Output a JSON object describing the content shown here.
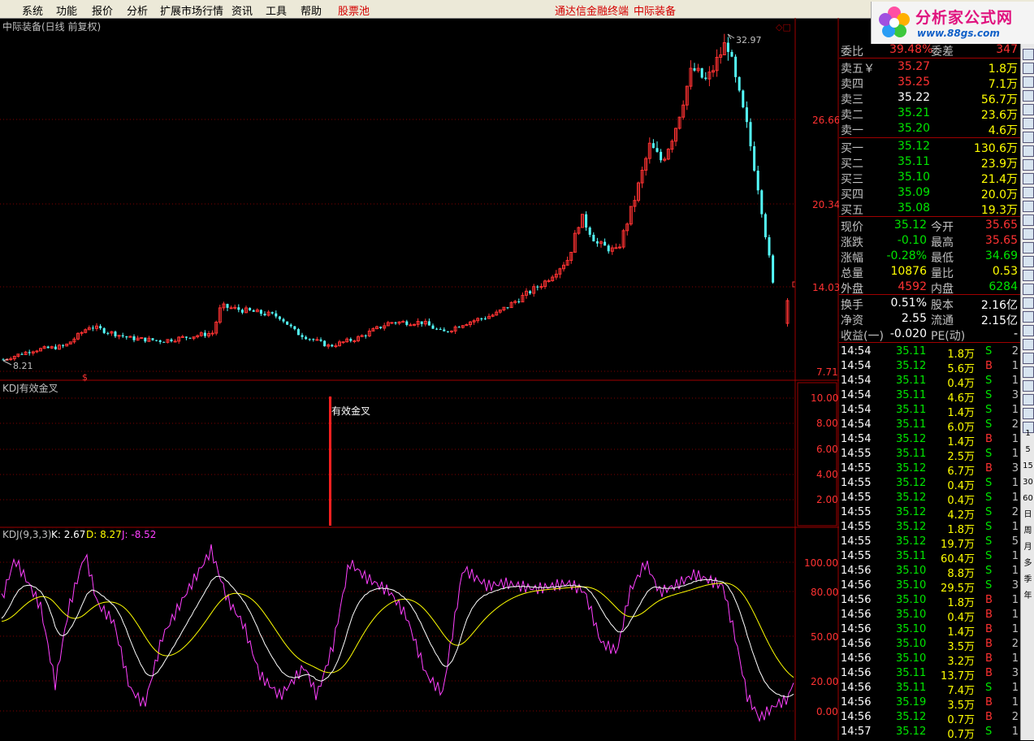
{
  "menu": {
    "items": [
      "系统",
      "功能",
      "报价",
      "分析",
      "扩展市场行情",
      "资讯",
      "工具",
      "帮助"
    ],
    "stock_pool": "股票池",
    "terminal": "通达信金融终端",
    "stock": "中际装备"
  },
  "logo": {
    "brand": "分析家公式网",
    "url": "www.88gs.com"
  },
  "panels": {
    "main_title": "中际装备(日线 前复权)",
    "signal_title": "KDJ有效金叉",
    "signal_text": "有效金叉",
    "kdj_title": "KDJ(9,3,3)",
    "kdj_k": "K: 2.67",
    "kdj_d": "D: 8.27",
    "kdj_j": "J: -8.52",
    "buy_marker": "$"
  },
  "chart_data": {
    "type": "candlestick",
    "price_axis_ticks": [
      "26.66",
      "20.34",
      "14.03",
      "7.71"
    ],
    "price_axis_values": [
      26.66,
      20.34,
      14.03,
      7.71
    ],
    "high_annotation": "32.97",
    "low_annotation": "8.21",
    "signal_axis_ticks": [
      "10.00",
      "8.00",
      "6.00",
      "4.00",
      "2.00"
    ],
    "kdj_axis_ticks": [
      "100.00",
      "80.00",
      "50.00",
      "20.00",
      "0.00"
    ],
    "colors": {
      "up": "#ff3232",
      "down": "#54fcfc",
      "grid": "#800000",
      "k": "#ffffff",
      "d": "#ffff00",
      "j": "#ff40ff"
    }
  },
  "quote": {
    "weibi_label": "委比",
    "weibi_value": "39.48%",
    "weicha_label": "委差",
    "weicha_value": "347",
    "asks": [
      {
        "label": "卖五￥",
        "price": "35.27",
        "vol": "1.8万",
        "pc": "r"
      },
      {
        "label": "卖四",
        "price": "35.25",
        "vol": "7.1万",
        "pc": "r"
      },
      {
        "label": "卖三",
        "price": "35.22",
        "vol": "56.7万",
        "pc": "w"
      },
      {
        "label": "卖二",
        "price": "35.21",
        "vol": "23.6万",
        "pc": "g"
      },
      {
        "label": "卖一",
        "price": "35.20",
        "vol": "4.6万",
        "pc": "g"
      }
    ],
    "bids": [
      {
        "label": "买一",
        "price": "35.12",
        "vol": "130.6万",
        "pc": "g"
      },
      {
        "label": "买二",
        "price": "35.11",
        "vol": "23.9万",
        "pc": "g"
      },
      {
        "label": "买三",
        "price": "35.10",
        "vol": "21.4万",
        "pc": "g"
      },
      {
        "label": "买四",
        "price": "35.09",
        "vol": "20.0万",
        "pc": "g"
      },
      {
        "label": "买五",
        "price": "35.08",
        "vol": "19.3万",
        "pc": "g"
      }
    ],
    "stats": [
      {
        "l1": "现价",
        "v1": "35.12",
        "c1": "g",
        "l2": "今开",
        "v2": "35.65",
        "c2": "r"
      },
      {
        "l1": "涨跌",
        "v1": "-0.10",
        "c1": "g",
        "l2": "最高",
        "v2": "35.65",
        "c2": "r"
      },
      {
        "l1": "涨幅",
        "v1": "-0.28%",
        "c1": "g",
        "l2": "最低",
        "v2": "34.69",
        "c2": "g"
      },
      {
        "l1": "总量",
        "v1": "10876",
        "c1": "y",
        "l2": "量比",
        "v2": "0.53",
        "c2": "y"
      },
      {
        "l1": "外盘",
        "v1": "4592",
        "c1": "r",
        "l2": "内盘",
        "v2": "6284",
        "c2": "g"
      }
    ],
    "stats2": [
      {
        "l1": "换手",
        "v1": "0.51%",
        "l2": "股本",
        "v2": "2.16亿"
      },
      {
        "l1": "净资",
        "v1": "2.55",
        "l2": "流通",
        "v2": "2.15亿"
      },
      {
        "l1": "收益(一)",
        "v1": "-0.020",
        "l2": "PE(动)",
        "v2": "-"
      }
    ]
  },
  "trades": [
    {
      "t": "14:54",
      "p": "35.11",
      "v": "1.8万",
      "s": "S",
      "n": "2"
    },
    {
      "t": "14:54",
      "p": "35.12",
      "v": "5.6万",
      "s": "B",
      "n": "1"
    },
    {
      "t": "14:54",
      "p": "35.11",
      "v": "0.4万",
      "s": "S",
      "n": "1"
    },
    {
      "t": "14:54",
      "p": "35.11",
      "v": "4.6万",
      "s": "S",
      "n": "3"
    },
    {
      "t": "14:54",
      "p": "35.11",
      "v": "1.4万",
      "s": "S",
      "n": "1"
    },
    {
      "t": "14:54",
      "p": "35.11",
      "v": "6.0万",
      "s": "S",
      "n": "2"
    },
    {
      "t": "14:54",
      "p": "35.12",
      "v": "1.4万",
      "s": "B",
      "n": "1"
    },
    {
      "t": "14:55",
      "p": "35.11",
      "v": "2.5万",
      "s": "S",
      "n": "1"
    },
    {
      "t": "14:55",
      "p": "35.12",
      "v": "6.7万",
      "s": "B",
      "n": "3"
    },
    {
      "t": "14:55",
      "p": "35.12",
      "v": "0.4万",
      "s": "S",
      "n": "1"
    },
    {
      "t": "14:55",
      "p": "35.12",
      "v": "0.4万",
      "s": "S",
      "n": "1"
    },
    {
      "t": "14:55",
      "p": "35.12",
      "v": "4.2万",
      "s": "S",
      "n": "2"
    },
    {
      "t": "14:55",
      "p": "35.12",
      "v": "1.8万",
      "s": "S",
      "n": "1"
    },
    {
      "t": "14:55",
      "p": "35.12",
      "v": "19.7万",
      "s": "S",
      "n": "5"
    },
    {
      "t": "14:55",
      "p": "35.11",
      "v": "60.4万",
      "s": "S",
      "n": "1"
    },
    {
      "t": "14:56",
      "p": "35.10",
      "v": "8.8万",
      "s": "S",
      "n": "1"
    },
    {
      "t": "14:56",
      "p": "35.10",
      "v": "29.5万",
      "s": "S",
      "n": "3"
    },
    {
      "t": "14:56",
      "p": "35.10",
      "v": "1.8万",
      "s": "B",
      "n": "1"
    },
    {
      "t": "14:56",
      "p": "35.10",
      "v": "0.4万",
      "s": "B",
      "n": "1"
    },
    {
      "t": "14:56",
      "p": "35.10",
      "v": "1.4万",
      "s": "B",
      "n": "1"
    },
    {
      "t": "14:56",
      "p": "35.10",
      "v": "3.5万",
      "s": "B",
      "n": "2"
    },
    {
      "t": "14:56",
      "p": "35.10",
      "v": "3.2万",
      "s": "B",
      "n": "1"
    },
    {
      "t": "14:56",
      "p": "35.11",
      "v": "13.7万",
      "s": "B",
      "n": "3"
    },
    {
      "t": "14:56",
      "p": "35.11",
      "v": "7.4万",
      "s": "S",
      "n": "1"
    },
    {
      "t": "14:56",
      "p": "35.19",
      "v": "3.5万",
      "s": "B",
      "n": "1"
    },
    {
      "t": "14:56",
      "p": "35.12",
      "v": "0.7万",
      "s": "B",
      "n": "2"
    },
    {
      "t": "14:57",
      "p": "35.12",
      "v": "0.7万",
      "s": "S",
      "n": "1"
    }
  ],
  "sidebar": {
    "labels": [
      "1",
      "5",
      "15",
      "30",
      "60",
      "日",
      "周",
      "月",
      "多",
      "季",
      "年"
    ]
  }
}
